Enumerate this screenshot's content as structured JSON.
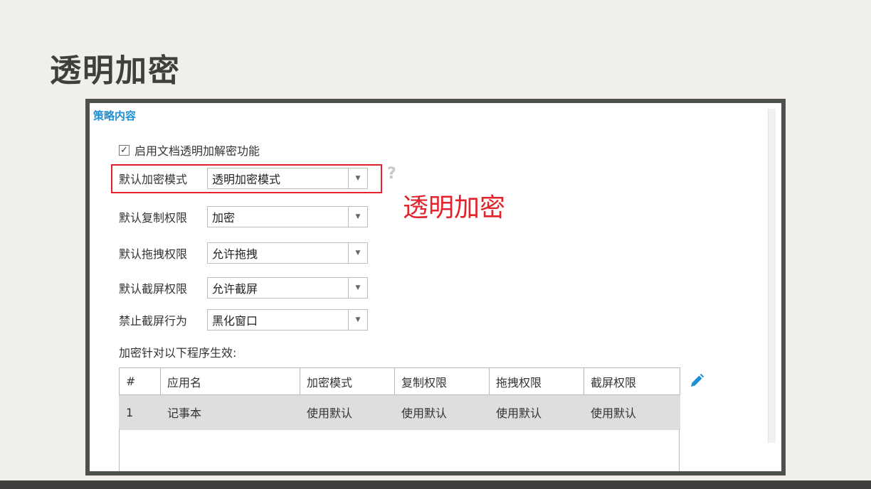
{
  "slide_title": "透明加密",
  "panel": {
    "section_title": "策略内容",
    "enable_checkbox": {
      "checked": true,
      "label": "启用文档透明加解密功能"
    },
    "fields": [
      {
        "label": "默认加密模式",
        "value": "透明加密模式"
      },
      {
        "label": "默认复制权限",
        "value": "加密"
      },
      {
        "label": "默认拖拽权限",
        "value": "允许拖拽"
      },
      {
        "label": "默认截屏权限",
        "value": "允许截屏"
      },
      {
        "label": "禁止截屏行为",
        "value": "黑化窗口"
      }
    ],
    "help_icon": "question-mark-icon",
    "callout": "透明加密",
    "apply_label": "加密针对以下程序生效:",
    "table": {
      "columns": [
        "#",
        "应用名",
        "加密模式",
        "复制权限",
        "拖拽权限",
        "截屏权限"
      ],
      "rows": [
        [
          "1",
          "记事本",
          "使用默认",
          "使用默认",
          "使用默认",
          "使用默认"
        ]
      ]
    },
    "edit_icon": "pencil-icon"
  },
  "colors": {
    "accent_blue": "#1d8fd6",
    "highlight_red": "#e2232b",
    "frame": "#4c514b",
    "background": "#f1efea"
  }
}
